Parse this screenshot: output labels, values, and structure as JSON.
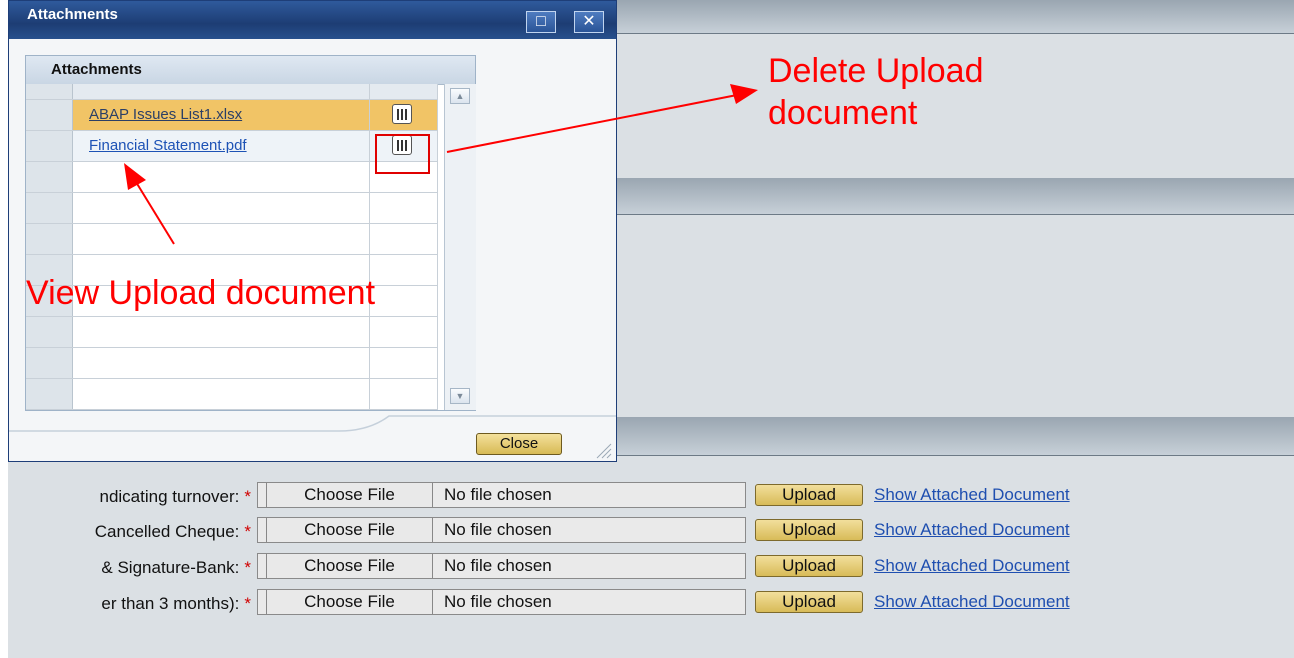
{
  "dialog": {
    "title": "Attachments",
    "panel_title": "Attachments",
    "maximize_glyph": "□",
    "close_glyph": "✕",
    "files": [
      {
        "name": "ABAP Issues List1.xlsx",
        "selected": true,
        "delete_icon": "trash-icon"
      },
      {
        "name": "Financial Statement.pdf",
        "selected": false,
        "delete_icon": "trash-icon"
      }
    ],
    "close_label": "Close"
  },
  "form": {
    "rows": [
      {
        "label": "ndicating turnover:",
        "choose_label": "Choose File",
        "file_status": "No file chosen",
        "upload_label": "Upload",
        "show_label": "Show Attached Document"
      },
      {
        "label": "Cancelled Cheque:",
        "choose_label": "Choose File",
        "file_status": "No file chosen",
        "upload_label": "Upload",
        "show_label": "Show Attached Document"
      },
      {
        "label": "& Signature-Bank:",
        "choose_label": "Choose File",
        "file_status": "No file chosen",
        "upload_label": "Upload",
        "show_label": "Show Attached Document"
      },
      {
        "label": "er than 3 months):",
        "choose_label": "Choose File",
        "file_status": "No file chosen",
        "upload_label": "Upload",
        "show_label": "Show Attached Document"
      }
    ],
    "required_marker": "*"
  },
  "annotations": {
    "delete_line1": "Delete Upload",
    "delete_line2": "document",
    "view": "View Upload document",
    "color": "#ff0000"
  },
  "colors": {
    "title_bar": "#1d3d74",
    "selected_row": "#f1c466",
    "link": "#1d52b5",
    "button": "#d8bb58"
  }
}
